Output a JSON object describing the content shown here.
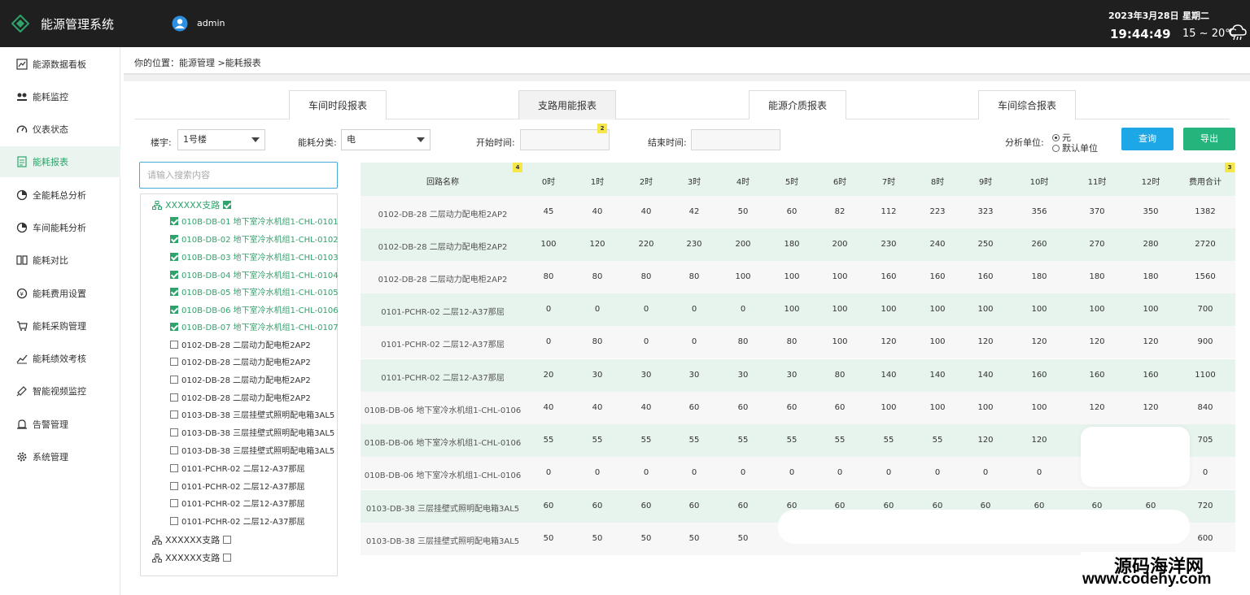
{
  "header": {
    "app_title": "能源管理系统",
    "user_name": "admin",
    "date": "2023年3月28日",
    "weekday": "星期二",
    "time": "19:44:49",
    "temperature": "15 ~ 20℃",
    "logo_icon": "diamond-logo-icon",
    "user_icon": "user-avatar-icon",
    "weather_icon": "cloud-rain-icon"
  },
  "sidebar": {
    "items": [
      {
        "label": "能源数据看板",
        "icon": "dashboard-icon"
      },
      {
        "label": "能耗监控",
        "icon": "monitor-icon"
      },
      {
        "label": "仪表状态",
        "icon": "gauge-icon"
      },
      {
        "label": "能耗报表",
        "icon": "report-icon"
      },
      {
        "label": "全能耗总分析",
        "icon": "pie-icon"
      },
      {
        "label": "车间能耗分析",
        "icon": "pie-icon"
      },
      {
        "label": "能耗对比",
        "icon": "compare-icon"
      },
      {
        "label": "能耗费用设置",
        "icon": "coin-icon"
      },
      {
        "label": "能耗采购管理",
        "icon": "cart-icon"
      },
      {
        "label": "能耗绩效考核",
        "icon": "trend-icon"
      },
      {
        "label": "智能视频监控",
        "icon": "camera-icon"
      },
      {
        "label": "告警管理",
        "icon": "alarm-icon"
      },
      {
        "label": "系统管理",
        "icon": "gear-icon"
      }
    ],
    "active_index": 3
  },
  "breadcrumb": "你的位置：能源管理 >能耗报表",
  "tabs": [
    "车间时段报表",
    "支路用能报表",
    "能源介质报表",
    "车间综合报表"
  ],
  "filters": {
    "building_label": "楼宇:",
    "building_value": "1号楼",
    "category_label": "能耗分类:",
    "category_value": "电",
    "start_label": "开始时间:",
    "end_label": "结束时间:",
    "unit_label": "分析单位:",
    "unit_options": [
      "元",
      "默认单位"
    ],
    "query_button": "查询",
    "export_button": "导出",
    "badge_start": "2"
  },
  "tree": {
    "search_placeholder": "请输入搜索内容",
    "group_label": "XXXXXX支路",
    "checked_items": [
      "010B-DB-01 地下室冷水机组1-CHL-0101",
      "010B-DB-02 地下室冷水机组1-CHL-0102",
      "010B-DB-03 地下室冷水机组1-CHL-0103",
      "010B-DB-04 地下室冷水机组1-CHL-0104",
      "010B-DB-05 地下室冷水机组1-CHL-0105",
      "010B-DB-06 地下室冷水机组1-CHL-0106",
      "010B-DB-07 地下室冷水机组1-CHL-0107"
    ],
    "unchecked_items": [
      "0102-DB-28 二层动力配电柜2AP2",
      "0102-DB-28 二层动力配电柜2AP2",
      "0102-DB-28 二层动力配电柜2AP2",
      "0102-DB-28 二层动力配电柜2AP2",
      "0103-DB-38 三层挂壁式照明配电箱3AL5",
      "0103-DB-38 三层挂壁式照明配电箱3AL5",
      "0103-DB-38 三层挂壁式照明配电箱3AL5",
      "0101-PCHR-02 二层12-A37那屈",
      "0101-PCHR-02 二层12-A37那屈",
      "0101-PCHR-02 二层12-A37那屈",
      "0101-PCHR-02 二层12-A37那屈"
    ],
    "extra_groups": [
      "XXXXXX支路",
      "XXXXXX支路"
    ]
  },
  "table": {
    "headers": [
      "回路名称",
      "0时",
      "1时",
      "2时",
      "3时",
      "4时",
      "5时",
      "6时",
      "7时",
      "8时",
      "9时",
      "10时",
      "11时",
      "12时",
      "费用合计"
    ],
    "badge_name": "4",
    "badge_total": "3",
    "rows": [
      [
        "0102-DB-28 二层动力配电柜2AP2",
        "45",
        "40",
        "40",
        "42",
        "50",
        "60",
        "82",
        "112",
        "223",
        "323",
        "356",
        "370",
        "350",
        "1382"
      ],
      [
        "0102-DB-28 二层动力配电柜2AP2",
        "100",
        "120",
        "220",
        "230",
        "200",
        "180",
        "200",
        "230",
        "240",
        "250",
        "260",
        "270",
        "280",
        "2720"
      ],
      [
        "0102-DB-28 二层动力配电柜2AP2",
        "80",
        "80",
        "80",
        "80",
        "100",
        "100",
        "100",
        "160",
        "160",
        "160",
        "180",
        "180",
        "180",
        "1560"
      ],
      [
        "0101-PCHR-02 二层12-A37那屈",
        "0",
        "0",
        "0",
        "0",
        "0",
        "100",
        "100",
        "100",
        "100",
        "100",
        "100",
        "100",
        "100",
        "700"
      ],
      [
        "0101-PCHR-02 二层12-A37那屈",
        "0",
        "80",
        "0",
        "0",
        "80",
        "80",
        "100",
        "120",
        "100",
        "120",
        "120",
        "120",
        "120",
        "900"
      ],
      [
        "0101-PCHR-02 二层12-A37那屈",
        "20",
        "30",
        "30",
        "30",
        "30",
        "30",
        "80",
        "140",
        "140",
        "140",
        "160",
        "160",
        "160",
        "1100"
      ],
      [
        "010B-DB-06 地下室冷水机组1-CHL-0106",
        "40",
        "40",
        "40",
        "60",
        "60",
        "60",
        "60",
        "100",
        "100",
        "100",
        "100",
        "120",
        "120",
        "840"
      ],
      [
        "010B-DB-06 地下室冷水机组1-CHL-0106",
        "55",
        "55",
        "55",
        "55",
        "55",
        "55",
        "55",
        "55",
        "55",
        "120",
        "120",
        "",
        "",
        "705"
      ],
      [
        "010B-DB-06 地下室冷水机组1-CHL-0106",
        "0",
        "0",
        "0",
        "0",
        "0",
        "0",
        "0",
        "0",
        "0",
        "0",
        "0",
        "",
        "",
        "0"
      ],
      [
        "0103-DB-38 三层挂壁式照明配电箱3AL5",
        "60",
        "60",
        "60",
        "60",
        "60",
        "60",
        "60",
        "60",
        "60",
        "60",
        "60",
        "60",
        "60",
        "720"
      ],
      [
        "0103-DB-38 三层挂壁式照明配电箱3AL5",
        "50",
        "50",
        "50",
        "50",
        "50",
        "",
        "",
        "",
        "",
        "",
        "",
        "",
        "",
        "600"
      ]
    ]
  },
  "watermark": {
    "line1": "源码海洋网",
    "line2": "www.codehy.com"
  },
  "colors": {
    "accent": "#2fa36b",
    "query_button": "#1ea7e6",
    "export_button": "#23b57c",
    "row_highlight": "#e7f4ed"
  }
}
